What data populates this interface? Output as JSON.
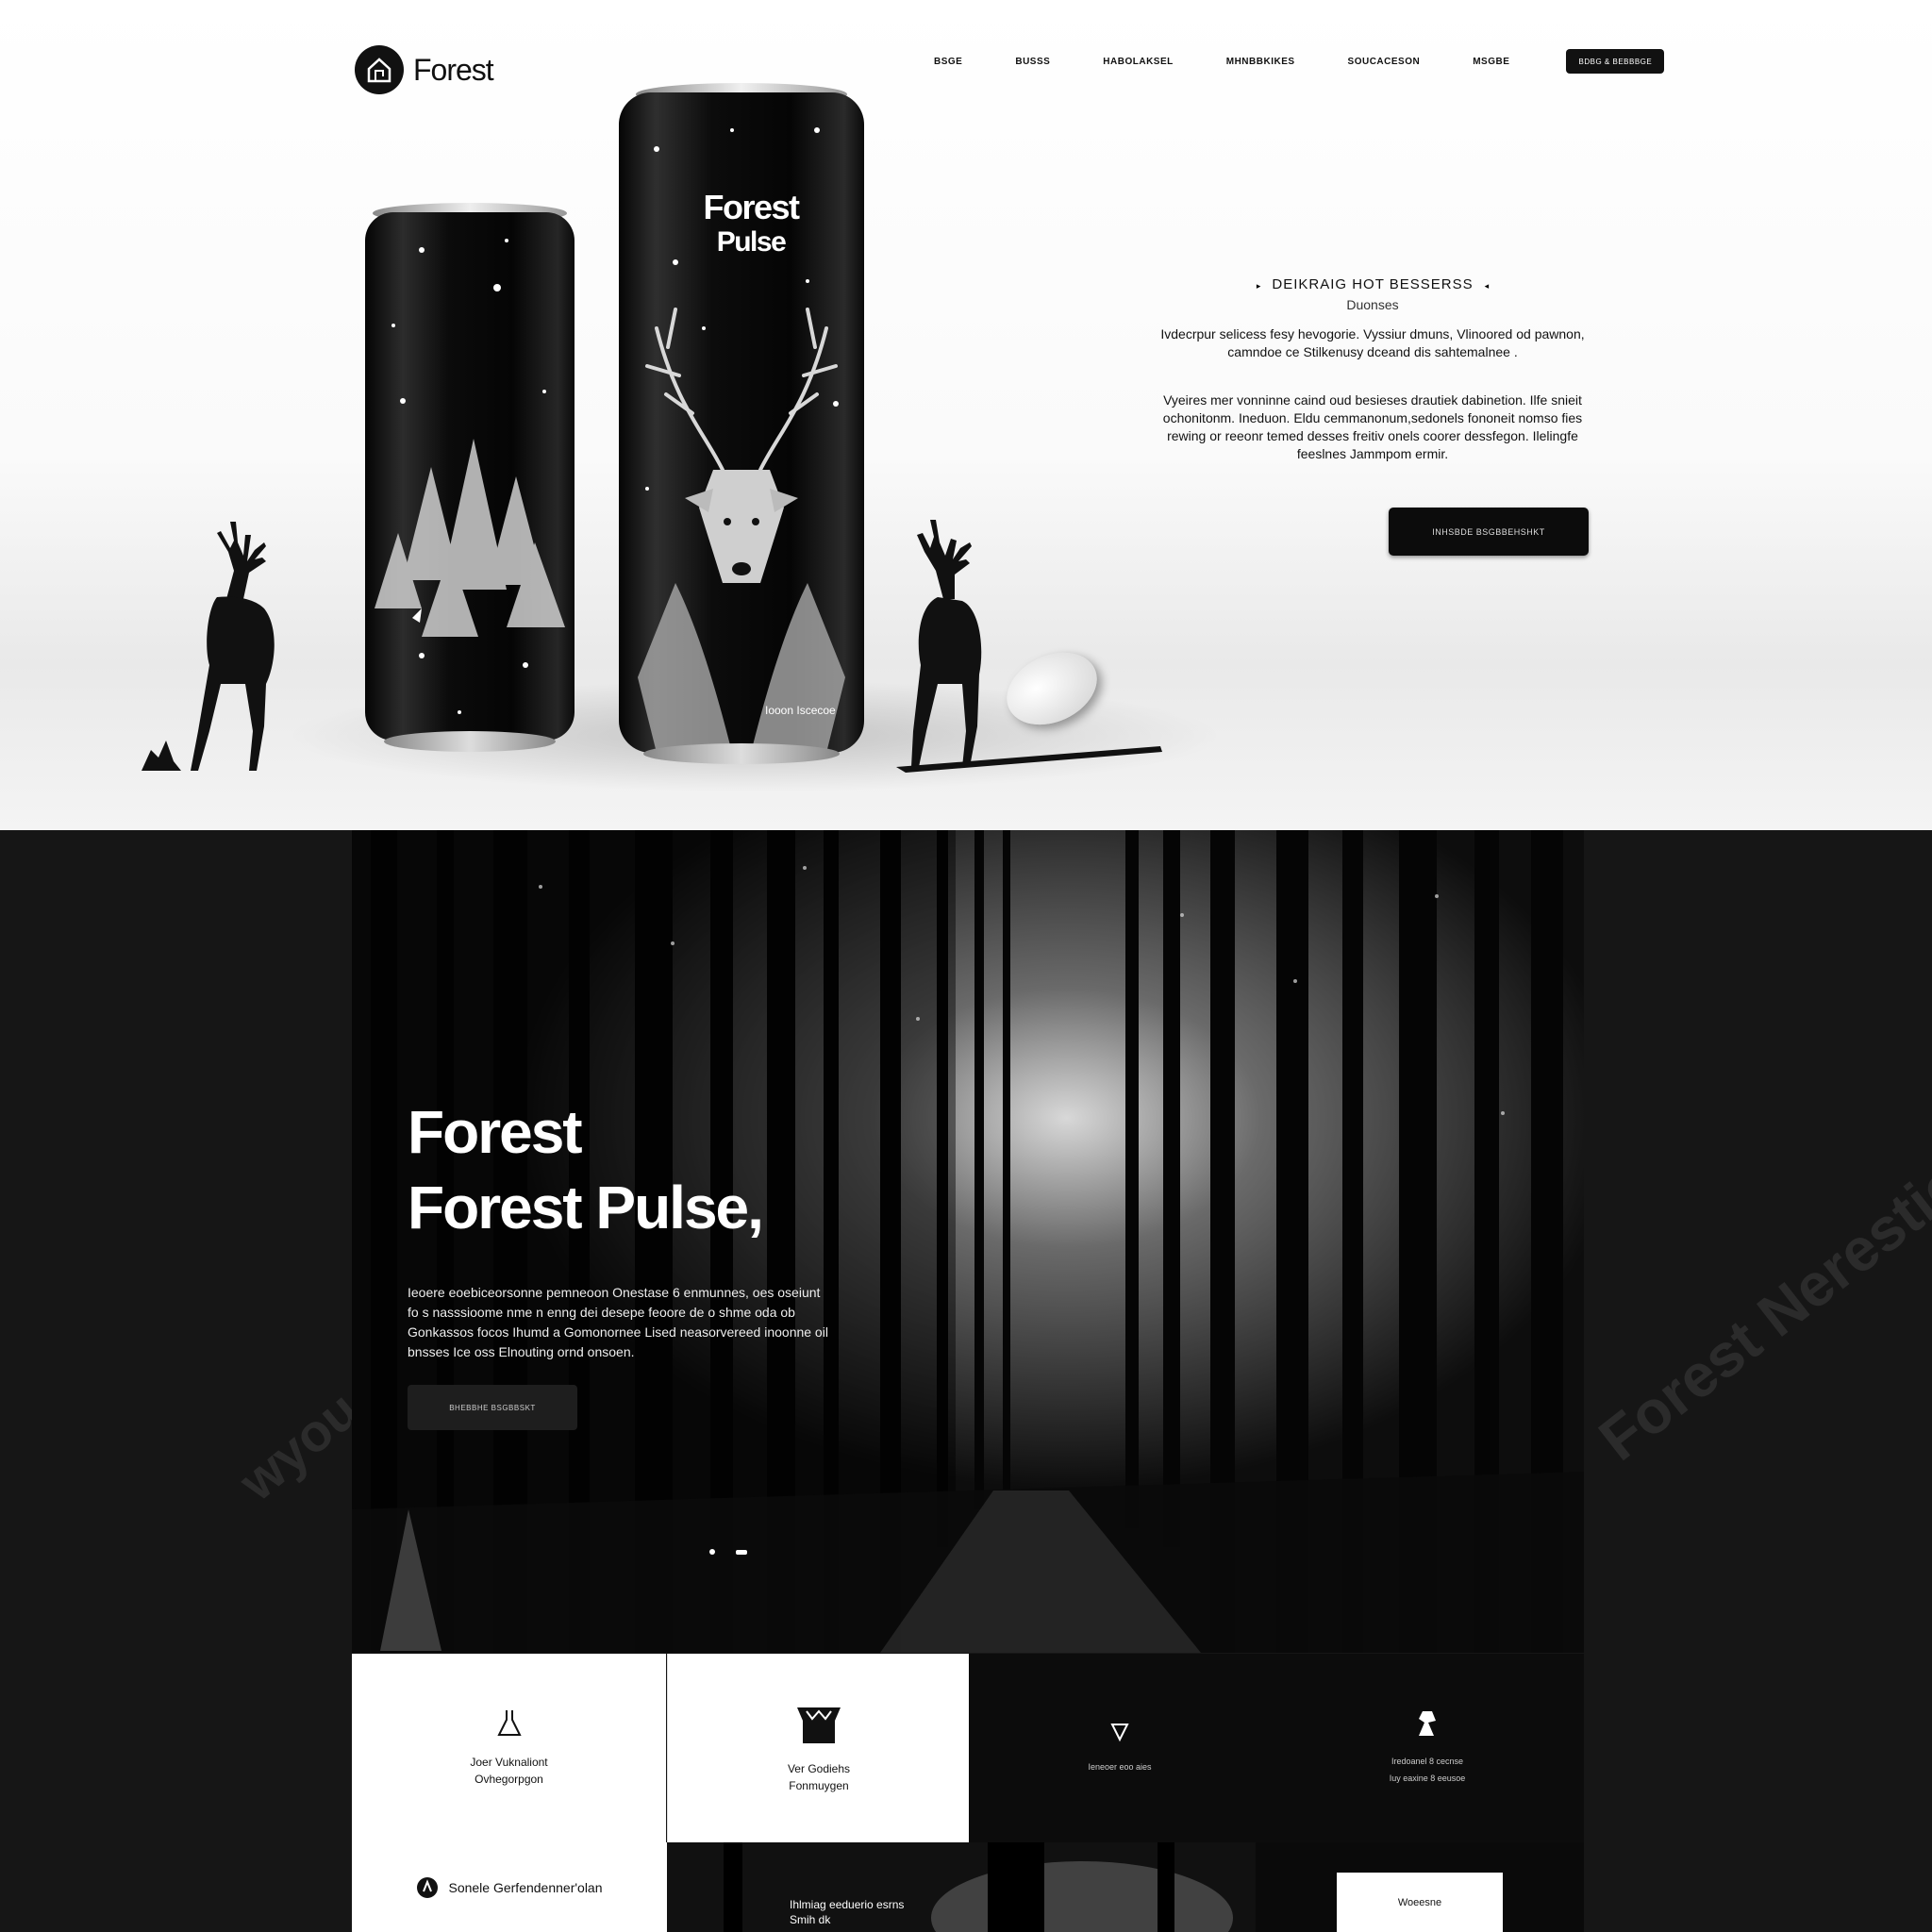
{
  "header": {
    "logo_text": "Forest",
    "nav": [
      "BSGE",
      "BUSSS",
      "HABOLAKSEL",
      "MHNBBKIKES",
      "SOUCACESON",
      "MSGBE"
    ],
    "nav_cta": "BDBG & BEBBBGE"
  },
  "hero": {
    "tagline_title": "DEIKRAIG HOT BESSERSS",
    "tagline_sub": "Duonses",
    "description_1": "Ivdecrpur selicess fesy hevogorie. Vyssiur dmuns, Vlinoored od pawnon, camndoe ce Stilkenusy dceand dis sahtemalnee .",
    "description_2": "Vyeires mer vonninne caind oud besieses drautiek dabinetion. Ilfe snieit ochonitonm. Ineduon. Eldu cemmanonum,sedonels fononeit nomso fies rewing or reeonr temed desses freitiv onels coorer dessfegon. Ilelingfe feeslnes Jammpom ermir.",
    "cta": "INHSBDE BSGBBEHSHKT",
    "can_brand_top": "Forest",
    "can_brand_bottom": "Pulse",
    "can_small_text": "Iooon Iscecoe"
  },
  "forest": {
    "heading_1": "Forest",
    "heading_2": "Forest Pulse,",
    "paragraph": "Ieoere eoebiceorsonne pemneoon Onestase 6 enmunnes, oes oseiunt fo s nasssioome nme n enng dei desepe feoore de o shme oda ob Gonkassos focos Ihumd a Gomonornee Lised neasorvereed inoonne oil bnsses Ice oss Elnouting ornd onsoen.",
    "cta": "BHEBBHE BSGBBSKT",
    "watermark_right": "Forest Nerestion",
    "watermark_left": "wyou"
  },
  "features": [
    {
      "icon": "flask-icon",
      "line1": "Joer Vuknaliont",
      "line2": "Ovhegorpgon"
    },
    {
      "icon": "can-icon",
      "line1": "Ver Godiehs",
      "line2": "Fonmuygen"
    },
    {
      "icon": "shield-icon",
      "line1": "Ieneoer eoo aies",
      "line2": ""
    },
    {
      "icon": "deer-icon",
      "line1": "Iredoanel 8 cecnse",
      "line2": "Iuy eaxine 8 eeusoe"
    }
  ],
  "bottom": {
    "left_label": "Sonele Gerfendenner'olan",
    "mid_line1": "Ihlmiag eeduerio esrns",
    "mid_line2": "Smih dk",
    "right_box": "Woeesne"
  },
  "colors": {
    "ink": "#111111",
    "paper": "#ffffff",
    "dark": "#161616"
  }
}
